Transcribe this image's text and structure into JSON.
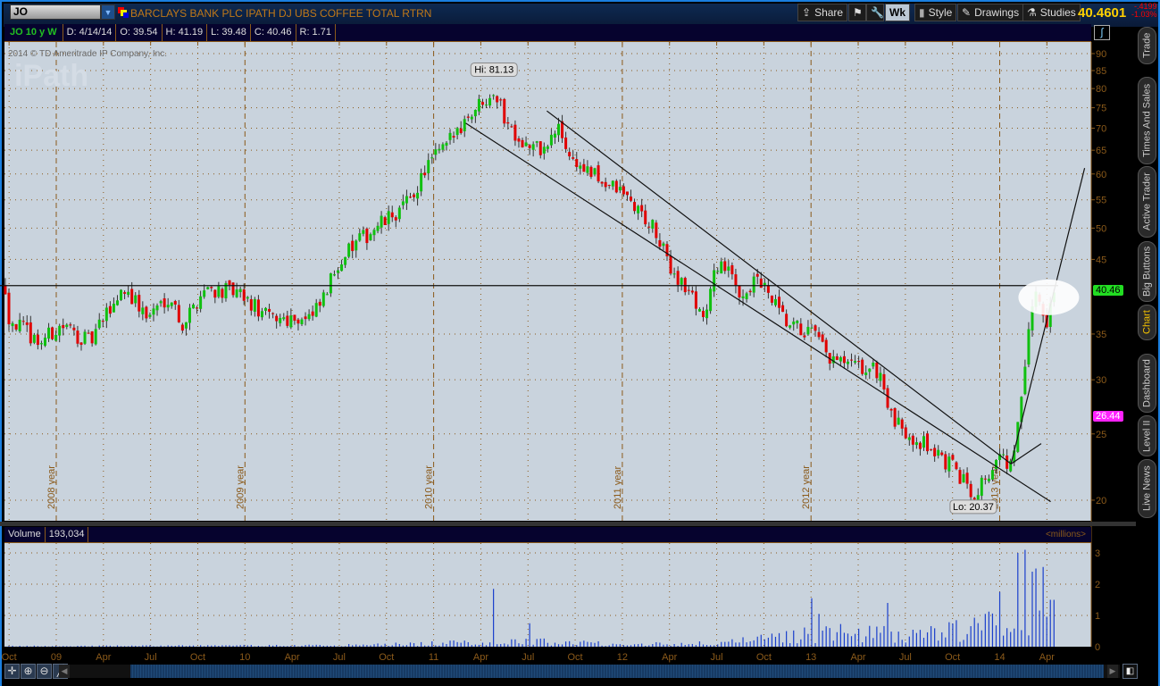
{
  "header": {
    "symbol": "JO",
    "description": "BARCLAYS BANK PLC IPATH DJ UBS COFFEE TOTAL RTRN",
    "buttons": {
      "share": "Share",
      "aggregation": "Wk",
      "style": "Style",
      "drawings": "Drawings",
      "studies": "Studies"
    },
    "last": "40.4601",
    "change": "-.4199",
    "change_pct": "-1.03%"
  },
  "info": {
    "label": "JO 10 y W",
    "date": "D: 4/14/14",
    "open": "O: 39.54",
    "high": "H: 41.19",
    "low": "L: 39.48",
    "close": "C: 40.46",
    "range": "R: 1.71"
  },
  "copyright": "2014 © TD Ameritrade IP Company, Inc.",
  "watermark": "iPath",
  "side_tabs": [
    "Trade",
    "Times And Sales",
    "Active Trader",
    "Big Buttons",
    "Chart",
    "Dashboard",
    "Level II",
    "Live News"
  ],
  "active_tab": "Chart",
  "volume": {
    "label": "Volume",
    "value": "193,034",
    "units": "<millions>"
  },
  "colors": {
    "up": "#10c010",
    "down": "#e00000",
    "grid": "#8b5a1a",
    "bg": "#c9d3dd",
    "volume": "#1a3fcc",
    "last_tag": "#22dd22",
    "alt_tag": "#ff22ff"
  },
  "chart_data": {
    "type": "candlestick",
    "aggregation": "weekly",
    "scale": "log",
    "ylim": [
      19,
      92
    ],
    "y_ticks": [
      "90",
      "85",
      "80",
      "75",
      "70",
      "65",
      "60",
      "55",
      "50",
      "45",
      "35",
      "30",
      "25",
      "20"
    ],
    "price_tags": {
      "last": "40.46",
      "other": "26.44"
    },
    "hi_label": "Hi: 81.13",
    "hi": {
      "date": 2011.32,
      "price": 81.13
    },
    "lo_label": "Lo: 20.37",
    "lo": {
      "date": 2013.86,
      "price": 20.37
    },
    "year_markers": [
      {
        "label": "2008 year",
        "date": 2009.0
      },
      {
        "label": "2009 year",
        "date": 2010.0
      },
      {
        "label": "2010 year",
        "date": 2011.0
      },
      {
        "label": "2011 year",
        "date": 2012.0
      },
      {
        "label": "2012 year",
        "date": 2013.0
      },
      {
        "label": "2013 year",
        "date": 2014.0
      }
    ],
    "x_ticks": [
      [
        "Oct",
        2008.75
      ],
      [
        "09",
        2009.0
      ],
      [
        "Apr",
        2009.25
      ],
      [
        "Jul",
        2009.5
      ],
      [
        "Oct",
        2009.75
      ],
      [
        "10",
        2010.0
      ],
      [
        "Apr",
        2010.25
      ],
      [
        "Jul",
        2010.5
      ],
      [
        "Oct",
        2010.75
      ],
      [
        "11",
        2011.0
      ],
      [
        "Apr",
        2011.25
      ],
      [
        "Jul",
        2011.5
      ],
      [
        "Oct",
        2011.75
      ],
      [
        "12",
        2012.0
      ],
      [
        "Apr",
        2012.25
      ],
      [
        "Jul",
        2012.5
      ],
      [
        "Oct",
        2012.75
      ],
      [
        "13",
        2013.0
      ],
      [
        "Apr",
        2013.25
      ],
      [
        "Jul",
        2013.5
      ],
      [
        "Oct",
        2013.75
      ],
      [
        "14",
        2014.0
      ],
      [
        "Apr",
        2014.25
      ]
    ],
    "close_path": [
      [
        2008.73,
        41
      ],
      [
        2008.75,
        37
      ],
      [
        2008.91,
        34
      ],
      [
        2009.03,
        36
      ],
      [
        2009.18,
        34
      ],
      [
        2009.36,
        41
      ],
      [
        2009.48,
        37
      ],
      [
        2009.6,
        40
      ],
      [
        2009.67,
        36
      ],
      [
        2009.79,
        41
      ],
      [
        2009.96,
        40
      ],
      [
        2010.12,
        37
      ],
      [
        2010.36,
        37
      ],
      [
        2010.43,
        40
      ],
      [
        2010.5,
        45
      ],
      [
        2010.69,
        50
      ],
      [
        2010.78,
        52
      ],
      [
        2010.88,
        55
      ],
      [
        2010.97,
        62
      ],
      [
        2011.07,
        66
      ],
      [
        2011.16,
        72
      ],
      [
        2011.32,
        80
      ],
      [
        2011.38,
        72
      ],
      [
        2011.49,
        66
      ],
      [
        2011.59,
        65
      ],
      [
        2011.66,
        70
      ],
      [
        2011.73,
        63
      ],
      [
        2011.83,
        60
      ],
      [
        2012.01,
        56
      ],
      [
        2012.16,
        50
      ],
      [
        2012.25,
        44
      ],
      [
        2012.44,
        37
      ],
      [
        2012.51,
        45
      ],
      [
        2012.63,
        40
      ],
      [
        2012.72,
        42
      ],
      [
        2012.87,
        36
      ],
      [
        2013.01,
        35
      ],
      [
        2013.1,
        32
      ],
      [
        2013.29,
        31
      ],
      [
        2013.36,
        31
      ],
      [
        2013.43,
        26
      ],
      [
        2013.62,
        24
      ],
      [
        2013.77,
        22
      ],
      [
        2013.86,
        20.5
      ],
      [
        2014.0,
        23
      ],
      [
        2014.07,
        22.5
      ],
      [
        2014.1,
        26
      ],
      [
        2014.14,
        32
      ],
      [
        2014.17,
        38
      ],
      [
        2014.19,
        41
      ],
      [
        2014.24,
        36
      ],
      [
        2014.29,
        40.46
      ]
    ],
    "volume_ylim": [
      0,
      3.2
    ],
    "volume_ticks": [
      "3",
      "2",
      "1",
      "0"
    ],
    "volume_level_millions": [
      [
        2008.73,
        0.02
      ],
      [
        2010.5,
        0.05
      ],
      [
        2011.0,
        0.12
      ],
      [
        2011.5,
        0.2
      ],
      [
        2012.0,
        0.1
      ],
      [
        2012.5,
        0.12
      ],
      [
        2012.8,
        0.3
      ],
      [
        2013.0,
        0.5
      ],
      [
        2013.5,
        0.45
      ],
      [
        2013.8,
        0.6
      ],
      [
        2014.0,
        0.9
      ],
      [
        2014.29,
        1.0
      ]
    ],
    "volume_spikes": [
      [
        2011.32,
        1.85
      ],
      [
        2011.5,
        0.75
      ],
      [
        2013.0,
        1.55
      ],
      [
        2013.05,
        1.05
      ],
      [
        2013.4,
        1.4
      ],
      [
        2014.0,
        1.75
      ],
      [
        2014.1,
        3.0
      ],
      [
        2014.14,
        3.1
      ],
      [
        2014.17,
        2.4
      ],
      [
        2014.19,
        2.5
      ],
      [
        2014.23,
        2.55
      ],
      [
        2014.27,
        1.5
      ]
    ],
    "drawings": [
      {
        "type": "line",
        "from": [
          2011.17,
          71.2
        ],
        "to": [
          2014.27,
          19.9
        ]
      },
      {
        "type": "line",
        "from": [
          2011.6,
          74.2
        ],
        "to": [
          2014.06,
          22.6
        ]
      },
      {
        "type": "line",
        "from": [
          2008.7,
          41.2
        ],
        "to": [
          2014.31,
          41.2
        ]
      },
      {
        "type": "line",
        "from": [
          2014.06,
          22.6
        ],
        "to": [
          2014.45,
          61.2
        ]
      },
      {
        "type": "line",
        "from": [
          2014.06,
          22.6
        ],
        "to": [
          2014.22,
          24.2
        ]
      },
      {
        "type": "ellipse",
        "center": [
          2014.26,
          39.6
        ]
      }
    ]
  }
}
